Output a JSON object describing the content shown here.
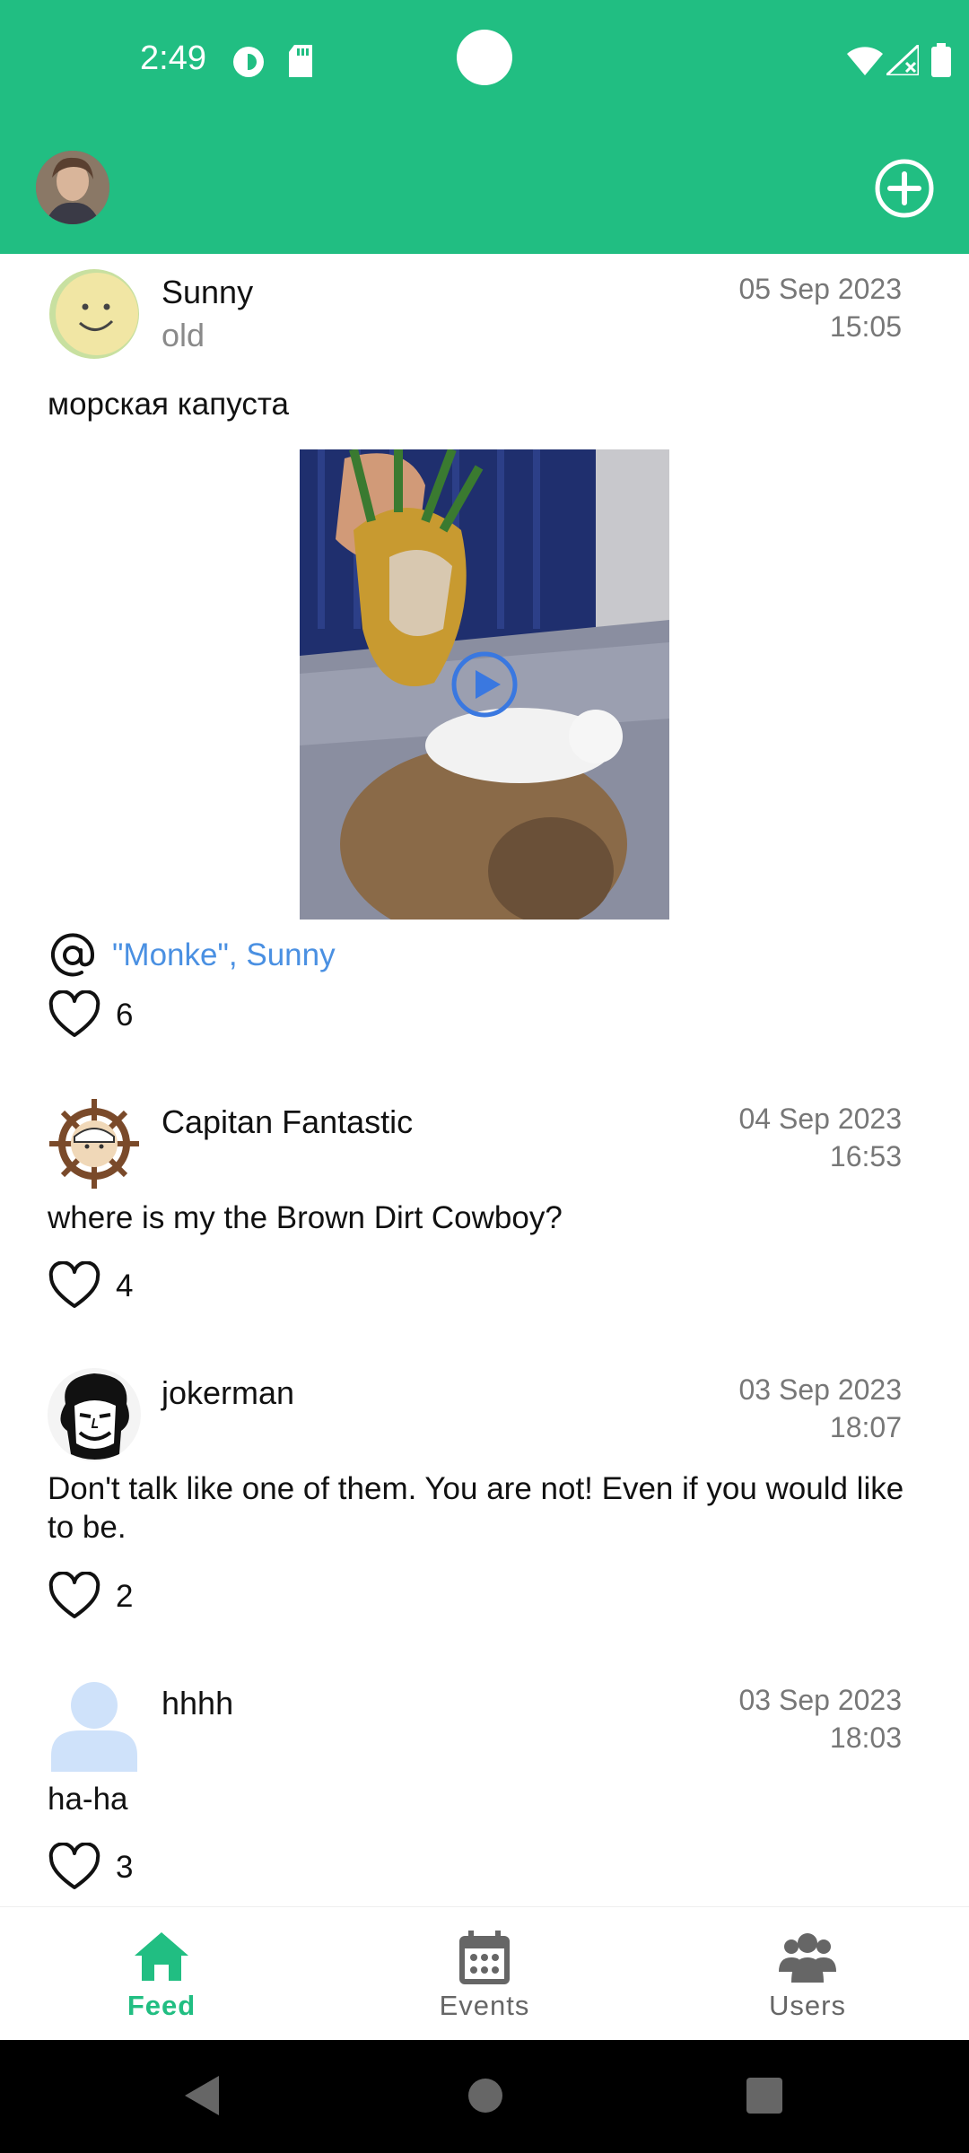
{
  "status_bar": {
    "time": "2:49"
  },
  "posts": [
    {
      "author": "Sunny",
      "subtitle": "old",
      "date": "05 Sep 2023",
      "time": "15:05",
      "text": "морская капуста",
      "mentions": "\"Monke\", Sunny",
      "likes": "6"
    },
    {
      "author": "Capitan Fantastic",
      "date": "04 Sep 2023",
      "time": "16:53",
      "text": "where is my the Brown Dirt Cowboy?",
      "likes": "4"
    },
    {
      "author": "jokerman",
      "date": "03 Sep 2023",
      "time": "18:07",
      "text": "Don't talk like one of them. You are not! Even if you would like to be.",
      "likes": "2"
    },
    {
      "author": "hhhh",
      "date": "03 Sep 2023",
      "time": "18:03",
      "text": "ha-ha",
      "likes": "3"
    }
  ],
  "bottom_nav": {
    "items": [
      {
        "label": "Feed",
        "icon": "home-icon",
        "active": true
      },
      {
        "label": "Events",
        "icon": "calendar-icon",
        "active": false
      },
      {
        "label": "Users",
        "icon": "users-icon",
        "active": false
      }
    ]
  },
  "colors": {
    "primary": "#21BE82",
    "link": "#4a90e2"
  }
}
